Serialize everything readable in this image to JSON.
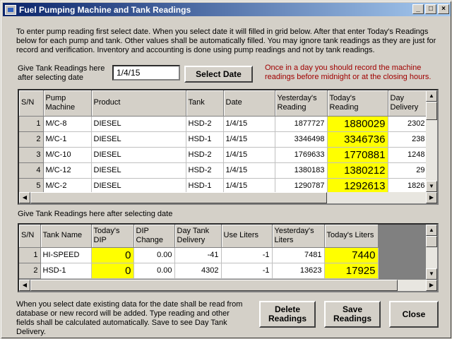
{
  "window": {
    "title": "Fuel Pumping Machine and Tank Readings",
    "controls": [
      "_",
      "□",
      "×"
    ]
  },
  "intro_text": "To enter pump reading first select date. When you select date it will filled in grid below. After that enter Today's Readings below for each pump and tank. Other values shall be automatically filled. You may ignore tank readings as they are just for record and verification. Inventory and accounting is done using pump readings and not by tank readings.",
  "date_label": "Give Tank Readings here after selecting  date",
  "date_value": "1/4/15",
  "select_date_label": "Select Date",
  "red_note": "Once in a day you should record the machine readings before midnight or at the closing hours.",
  "pump_grid": {
    "headers": [
      "S/N",
      "Pump Machine",
      "Product",
      "Tank",
      "Date",
      "Yesterday's Reading",
      "Today's Reading",
      "Day Delivery"
    ],
    "rows": [
      [
        "1",
        "M/C-8",
        "DIESEL",
        "HSD-2",
        "1/4/15",
        "1877727",
        "1880029",
        "2302"
      ],
      [
        "2",
        "M/C-1",
        "DIESEL",
        "HSD-1",
        "1/4/15",
        "3346498",
        "3346736",
        "238"
      ],
      [
        "3",
        "M/C-10",
        "DIESEL",
        "HSD-2",
        "1/4/15",
        "1769633",
        "1770881",
        "1248"
      ],
      [
        "4",
        "M/C-12",
        "DIESEL",
        "HSD-2",
        "1/4/15",
        "1380183",
        "1380212",
        "29"
      ],
      [
        "5",
        "M/C-2",
        "DIESEL",
        "HSD-1",
        "1/4/15",
        "1290787",
        "1292613",
        "1826"
      ]
    ]
  },
  "tank_label": "Give Tank Readings here after selecting  date",
  "tank_grid": {
    "headers": [
      "S/N",
      "Tank Name",
      "Today's DIP",
      "DIP Change",
      "Day Tank Delivery",
      "Use Liters",
      "Yesterday's Liters",
      "Today's Liters"
    ],
    "rows": [
      [
        "1",
        "HI-SPEED",
        "0",
        "0.00",
        "-41",
        "-1",
        "7481",
        "7440"
      ],
      [
        "2",
        "HSD-1",
        "0",
        "0.00",
        "4302",
        "-1",
        "13623",
        "17925"
      ]
    ]
  },
  "footer_text": "When you select date existing data for the date shall be read from database or new record will be added. Type reading and other fields shall be calculated automatically. Save to see Day Tank Delivery.",
  "buttons": {
    "delete": "Delete Readings",
    "save": "Save Readings",
    "close": "Close"
  },
  "colors": {
    "highlight": "#ffff00",
    "note": "#a00000",
    "title_start": "#0a246a"
  }
}
